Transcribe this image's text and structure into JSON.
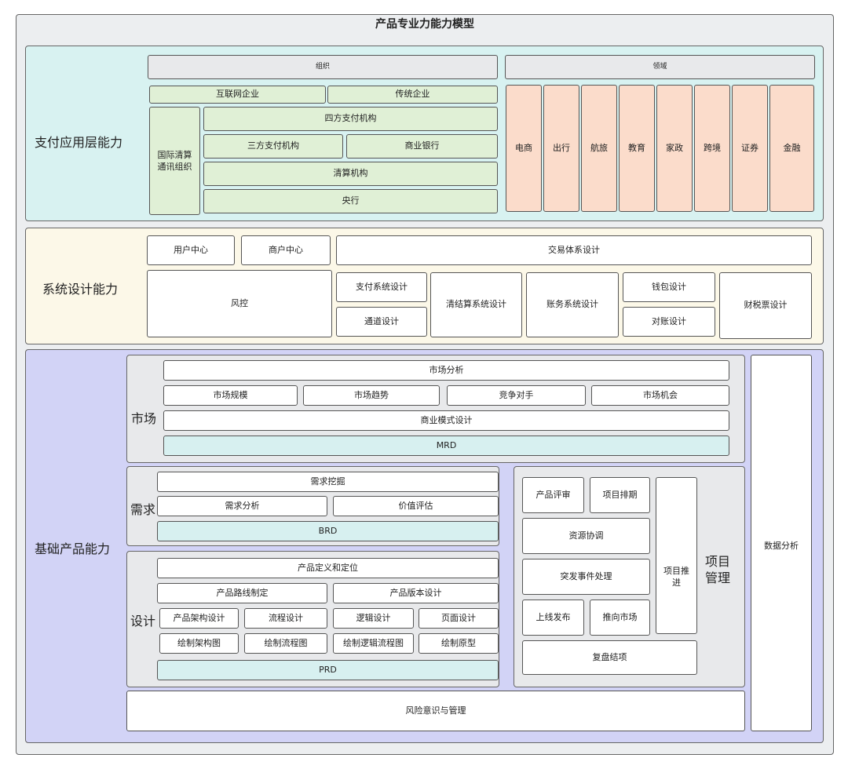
{
  "title": "产品专业力能力模型",
  "payment": {
    "label": "支付应用层能力",
    "org_header": "组织",
    "domain_header": "领域",
    "internet_company": "互联网企业",
    "traditional_company": "传统企业",
    "intl_clearing": "国际清算\n通讯组织",
    "four_party": "四方支付机构",
    "third_party": "三方支付机构",
    "commercial_bank": "商业银行",
    "clearing_org": "清算机构",
    "central_bank": "央行",
    "domains": [
      "电商",
      "出行",
      "航旅",
      "教育",
      "家政",
      "跨境",
      "证券",
      "金融"
    ]
  },
  "system": {
    "label": "系统设计能力",
    "user_center": "用户中心",
    "merchant_center": "商户中心",
    "trade_system": "交易体系设计",
    "risk_control": "风控",
    "pay_system": "支付系统设计",
    "channel": "通道设计",
    "settlement": "清结算系统设计",
    "accounting": "账务系统设计",
    "wallet": "钱包设计",
    "reconciliation": "对账设计",
    "finance_tax": "财税票设计"
  },
  "base": {
    "label": "基础产品能力",
    "market": {
      "label": "市场",
      "analysis": "市场分析",
      "scale": "市场规模",
      "trend": "市场趋势",
      "competitor": "竞争对手",
      "opportunity": "市场机会",
      "business_model": "商业模式设计",
      "mrd": "MRD"
    },
    "demand": {
      "label": "需求",
      "mining": "需求挖掘",
      "analysis": "需求分析",
      "value": "价值评估",
      "brd": "BRD"
    },
    "design": {
      "label": "设计",
      "definition": "产品定义和定位",
      "roadmap": "产品路线制定",
      "version": "产品版本设计",
      "architecture": "产品架构设计",
      "flow": "流程设计",
      "logic": "逻辑设计",
      "page": "页面设计",
      "draw_arch": "绘制架构图",
      "draw_flow": "绘制流程图",
      "draw_logic": "绘制逻辑流程图",
      "draw_proto": "绘制原型",
      "prd": "PRD"
    },
    "project": {
      "label": "项目\n管理",
      "review": "产品评审",
      "schedule": "项目排期",
      "resource": "资源协调",
      "emergency": "突发事件处理",
      "launch": "上线发布",
      "promote": "推向市场",
      "retro": "复盘结项",
      "advance": "项目推\n进"
    },
    "data_analysis": "数据分析",
    "risk_awareness": "风险意识与管理"
  }
}
